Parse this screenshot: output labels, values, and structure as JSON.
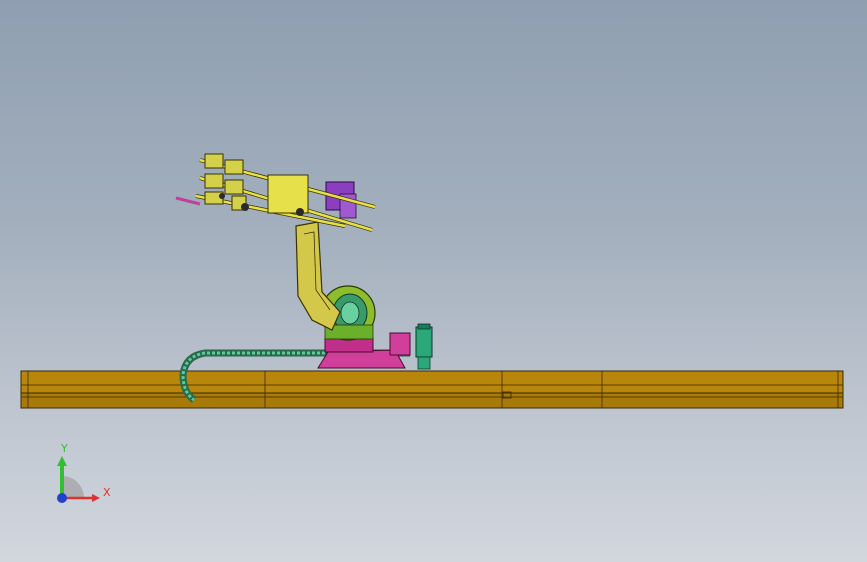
{
  "viewport": {
    "background_top": "#8f9fb1",
    "background_bottom": "#d2d7de"
  },
  "model": {
    "parts": [
      {
        "name": "linear-track-rail",
        "color": "#b8860b"
      },
      {
        "name": "robot-base",
        "color": "#d0409a"
      },
      {
        "name": "robot-turret",
        "color": "#8dbd2c"
      },
      {
        "name": "robot-lower-arm",
        "color": "#d4c84a"
      },
      {
        "name": "end-effector-tooling",
        "color": "#e6e04a"
      },
      {
        "name": "wrist-motor",
        "color": "#8a3fc0"
      },
      {
        "name": "cable-carrier",
        "color": "#3a9a6a"
      },
      {
        "name": "control-cabinet",
        "color": "#2aa87a"
      }
    ]
  },
  "triad": {
    "x_label": "X",
    "y_label": "Y",
    "x_color": "#e03030",
    "y_color": "#30c030",
    "z_color": "#2040d0"
  }
}
